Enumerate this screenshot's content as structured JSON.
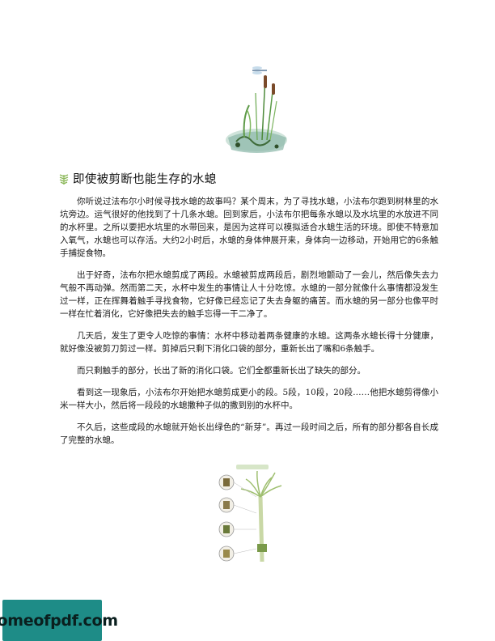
{
  "heading": {
    "title": "即使被剪断也能生存的水螅"
  },
  "paragraphs": [
    "你听说过法布尔小时候寻找水螅的故事吗？某个周末，为了寻找水螅，小法布尔跑到树林里的水坑旁边。运气很好的他找到了十几条水螅。回到家后，小法布尔把每条水螅以及水坑里的水放进不同的水杯里。之所以要把水坑里的水带回来，是因为这样可以模拟适合水螅生活的环境。即使不特意加入氧气，水螅也可以存活。大约2小时后，水螅的身体伸展开来，身体向一边移动，开始用它的6条触手捕捉食物。",
    "出于好奇，法布尔把水螅剪成了两段。水螅被剪成两段后，剧烈地颤动了一会儿，然后像失去力气般不再动弹。然而第二天，水杯中发生的事情让人十分吃惊。水螅的一部分就像什么事情都没发生过一样，正在挥舞着触手寻找食物，它好像已经忘记了失去身躯的痛苦。而水螅的另一部分也像平时一样在忙着消化，它好像把失去的触手忘得一干二净了。",
    "几天后，发生了更令人吃惊的事情：水杯中移动着两条健康的水螅。这两条水螅长得十分健康，就好像没被剪刀剪过一样。剪掉后只剩下消化口袋的部分，重新长出了嘴和6条触手。",
    "而只剩触手的部分，长出了新的消化口袋。它们全都重新长出了缺失的部分。",
    "看到这一现象后，小法布尔开始把水螅剪成更小的段。5段，10段，20段……他把水螅剪得像小米一样大小，然后将一段段的水螅撒种子似的撒到别的水杯中。",
    "不久后，这些成段的水螅就开始长出绿色的“新芽”。再过一段时间之后，所有的部分都各自长成了完整的水螅。"
  ],
  "watermark": {
    "text": "homeofpdf.com"
  },
  "colors": {
    "watermark_bg": "#1e8c87",
    "leaf_icon": "#8cb85a"
  }
}
